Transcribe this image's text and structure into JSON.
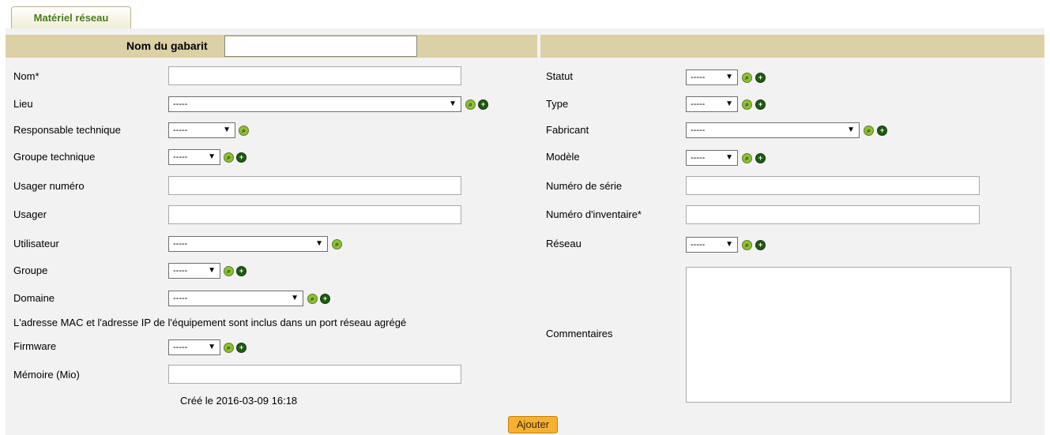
{
  "tab": {
    "label": "Matériel réseau"
  },
  "template": {
    "label": "Nom du gabarit",
    "value": ""
  },
  "left": {
    "name": {
      "label": "Nom*",
      "value": ""
    },
    "location": {
      "label": "Lieu",
      "value": "-----"
    },
    "tech_responsible": {
      "label": "Responsable technique",
      "value": "-----"
    },
    "tech_group": {
      "label": "Groupe technique",
      "value": "-----"
    },
    "user_number": {
      "label": "Usager numéro",
      "value": ""
    },
    "usager": {
      "label": "Usager",
      "value": ""
    },
    "user": {
      "label": "Utilisateur",
      "value": "-----"
    },
    "group": {
      "label": "Groupe",
      "value": "-----"
    },
    "domain": {
      "label": "Domaine",
      "value": "-----"
    },
    "mac_notice": "L'adresse MAC et l'adresse IP de l'équipement sont inclus dans un port réseau agrégé",
    "firmware": {
      "label": "Firmware",
      "value": "-----"
    },
    "memory": {
      "label": "Mémoire (Mio)",
      "value": ""
    },
    "created": "Créé le 2016-03-09 16:18"
  },
  "right": {
    "status": {
      "label": "Statut",
      "value": "-----"
    },
    "type": {
      "label": "Type",
      "value": "-----"
    },
    "manufacturer": {
      "label": "Fabricant",
      "value": "-----"
    },
    "model": {
      "label": "Modèle",
      "value": "-----"
    },
    "serial": {
      "label": "Numéro de série",
      "value": ""
    },
    "inventory": {
      "label": "Numéro d'inventaire*",
      "value": ""
    },
    "network": {
      "label": "Réseau",
      "value": "-----"
    },
    "comments": {
      "label": "Commentaires",
      "value": ""
    }
  },
  "actions": {
    "add": "Ajouter"
  },
  "icons": {
    "search": "search-icon",
    "add": "add-icon"
  },
  "colors": {
    "header": "#dcd0a6",
    "tab_text": "#4c7a1d",
    "button": "#f6b132",
    "panel": "#f2f2f2"
  }
}
